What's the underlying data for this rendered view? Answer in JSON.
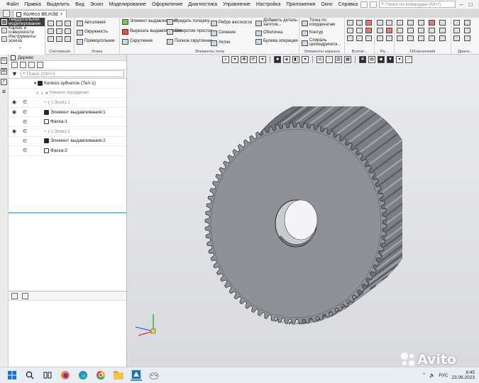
{
  "menu": {
    "items": [
      "Файл",
      "Правка",
      "Выделить",
      "Вид",
      "Эскиз",
      "Моделирование",
      "Оформление",
      "Диагностика",
      "Управление",
      "Настройка",
      "Приложения",
      "Окно",
      "Справка"
    ],
    "search_placeholder": "Поиск по командам (Alt+/)"
  },
  "document_tab": {
    "title": "Колесо 88.m3d",
    "close": "×"
  },
  "modes": [
    "Твердотельное моделирование",
    "Каркас и поверхности",
    "Инструменты эскиза"
  ],
  "ribbon": {
    "groups": {
      "system": "Системная",
      "sketch": "Эскиз",
      "body_elements": "Элементы тела",
      "frame_elements": "Элементы каркаса",
      "aux": "Вспом...",
      "dims": "Ра...",
      "notation": "Обозначения",
      "diag": "Диагн..."
    },
    "sketch_buttons": [
      "Автолиния",
      "Окружность",
      "Прямоугольник"
    ],
    "body_col1": [
      "Элемент выдавливания",
      "Вырезать выдавливанием",
      "Скругление"
    ],
    "body_col2": [
      "Придать толщину",
      "Отверстие простое",
      "Полное скругление"
    ],
    "body_col3": [
      "Ребро жесткости",
      "Сечение",
      "Уклон"
    ],
    "body_col4": [
      "Добавить деталь-заготов...",
      "Оболочка",
      "Булева операция"
    ],
    "frame_col": [
      "Точка по координатам",
      "Контур",
      "Спираль цилиндрическ..."
    ]
  },
  "panel": {
    "title": "Дерево",
    "filter_placeholder": "Поиск (Ctrl+/)",
    "tree": [
      {
        "label": "Колесо зубчатое (Тел-1)",
        "eye": "",
        "fix": "",
        "dim": false
      },
      {
        "label": "Начало координат",
        "eye": "",
        "fix": "",
        "dim": true
      },
      {
        "label": "(-) Эскиз:1",
        "eye": "◉",
        "fix": "∈",
        "dim": true
      },
      {
        "label": "Элемент выдавливания:1",
        "eye": "◉",
        "fix": "∈",
        "dim": false
      },
      {
        "label": "Фаска:1",
        "eye": "",
        "fix": "∈",
        "dim": false
      },
      {
        "label": "(-) Эскиз:2",
        "eye": "◉",
        "fix": "∈",
        "dim": true
      },
      {
        "label": "Элемент выдавливания:2",
        "eye": "",
        "fix": "∈",
        "dim": false
      },
      {
        "label": "Фаска:2",
        "eye": "",
        "fix": "∈",
        "dim": false
      }
    ]
  },
  "model": {
    "teeth": 80,
    "color": "#8f9196"
  },
  "taskbar": {
    "lang": "РУС",
    "time": "8:45",
    "date": "23.06.2023"
  },
  "watermark": "Avito",
  "colors": {
    "accent": "#6fc9e0",
    "active_mode": "#3c3c3c"
  }
}
